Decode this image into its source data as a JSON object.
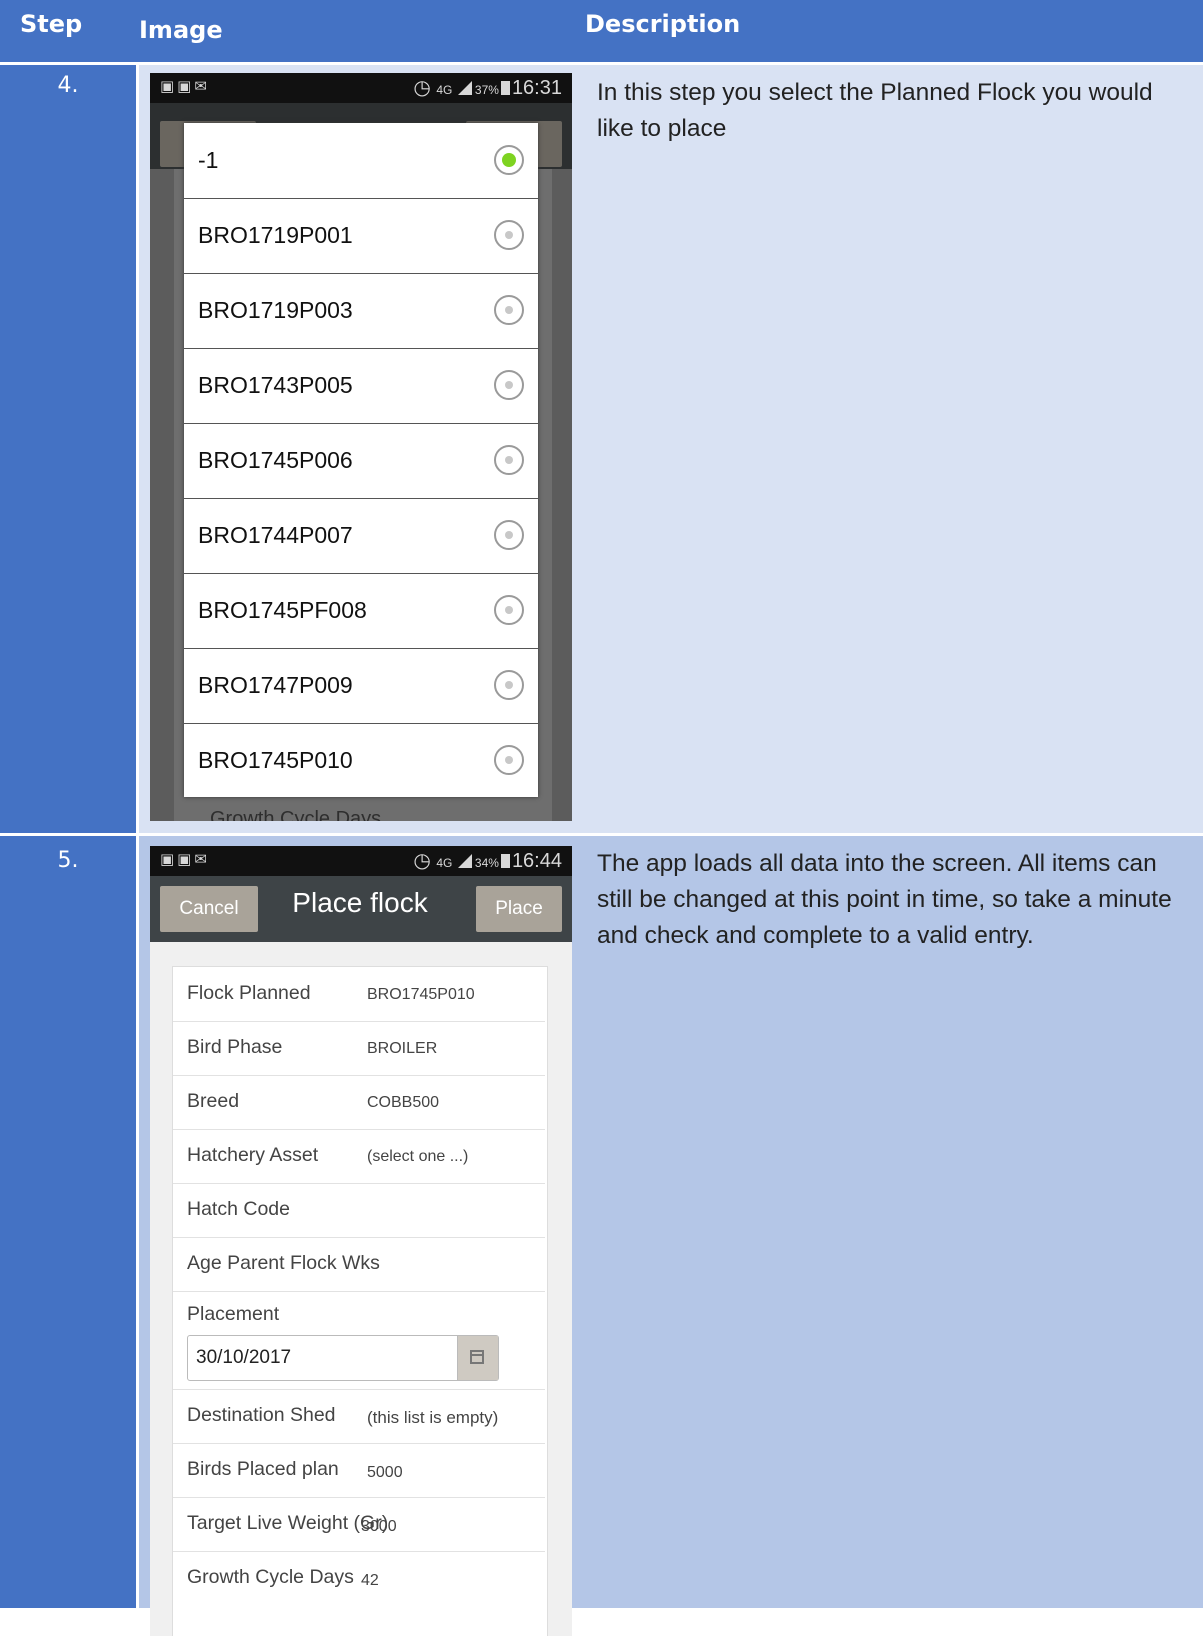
{
  "table": {
    "headers": {
      "step": "Step",
      "image": "Image",
      "description": "Description"
    }
  },
  "rows": [
    {
      "step": "4.",
      "description": "In this step you select the Planned Flock you would like to place",
      "phone": {
        "status_time": "16:31",
        "status_battery": "37%",
        "status_network": "4G",
        "dialog_options": [
          {
            "label": "-1",
            "selected": true
          },
          {
            "label": "BRO1719P001",
            "selected": false
          },
          {
            "label": "BRO1719P003",
            "selected": false
          },
          {
            "label": "BRO1743P005",
            "selected": false
          },
          {
            "label": "BRO1745P006",
            "selected": false
          },
          {
            "label": "BRO1744P007",
            "selected": false
          },
          {
            "label": "BRO1745PF008",
            "selected": false
          },
          {
            "label": "BRO1747P009",
            "selected": false
          },
          {
            "label": "BRO1745P010",
            "selected": false
          }
        ],
        "background_label": "Growth Cycle Days"
      }
    },
    {
      "step": "5.",
      "description": "The app loads all data into the screen. All items can still be changed at this point in time, so take a minute and check and complete to a valid entry.",
      "phone": {
        "status_time": "16:44",
        "status_battery": "34%",
        "status_network": "4G",
        "cancel_label": "Cancel",
        "title": "Place flock",
        "place_label": "Place",
        "fields": {
          "flock_planned": {
            "label": "Flock Planned",
            "value": "BRO1745P010"
          },
          "bird_phase": {
            "label": "Bird Phase",
            "value": "BROILER"
          },
          "breed": {
            "label": "Breed",
            "value": "COBB500"
          },
          "hatchery_asset": {
            "label": "Hatchery Asset",
            "value": "(select one ...)"
          },
          "hatch_code": {
            "label": "Hatch Code",
            "value": ""
          },
          "age_parent": {
            "label": "Age Parent Flock Wks",
            "value": ""
          },
          "placement": {
            "label": "Placement",
            "value": "30/10/2017"
          },
          "destination_shed": {
            "label": "Destination Shed",
            "value": "(this list is empty)"
          },
          "birds_placed": {
            "label": "Birds Placed plan",
            "value": "5000"
          },
          "target_weight": {
            "label": "Target Live Weight (Gr)",
            "value": "3000"
          },
          "growth_cycle": {
            "label": "Growth Cycle Days",
            "value": "42"
          }
        }
      }
    }
  ],
  "colors": {
    "header_blue": "#4472c4",
    "row4_desc_bg": "#d9e2f3",
    "row5_desc_bg": "#b4c6e7",
    "row4_img_bg": "#d9e2f3",
    "row5_img_bg": "#b4c6e7"
  },
  "icons": [
    "notification-icon",
    "image-icon",
    "mail-icon",
    "alarm-icon",
    "signal-icon",
    "battery-icon",
    "radio-button-icon",
    "calendar-icon"
  ]
}
